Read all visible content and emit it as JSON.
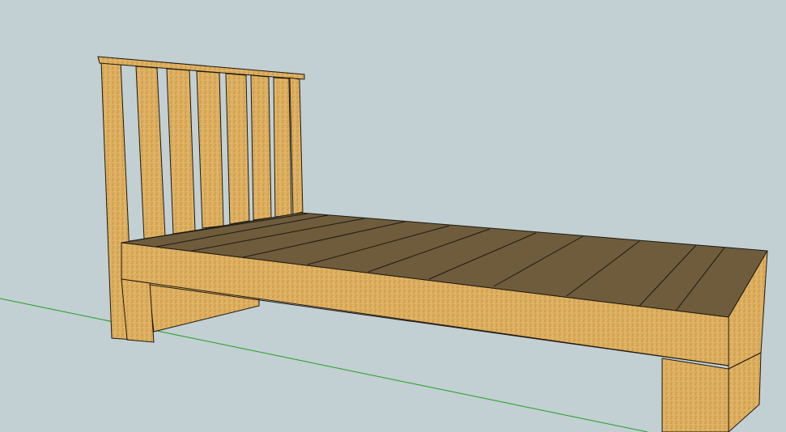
{
  "scene": {
    "background_color": "#c2cfd3",
    "axis_color": "#1fa01f",
    "wood_color": "#dcae5f",
    "wood_dark_color": "#c9923c",
    "deck_color": "#6e5c3d",
    "edge_color": "#1e1a10",
    "model": "bed-frame",
    "headboard_slats": 6,
    "deck_planks": 11
  }
}
